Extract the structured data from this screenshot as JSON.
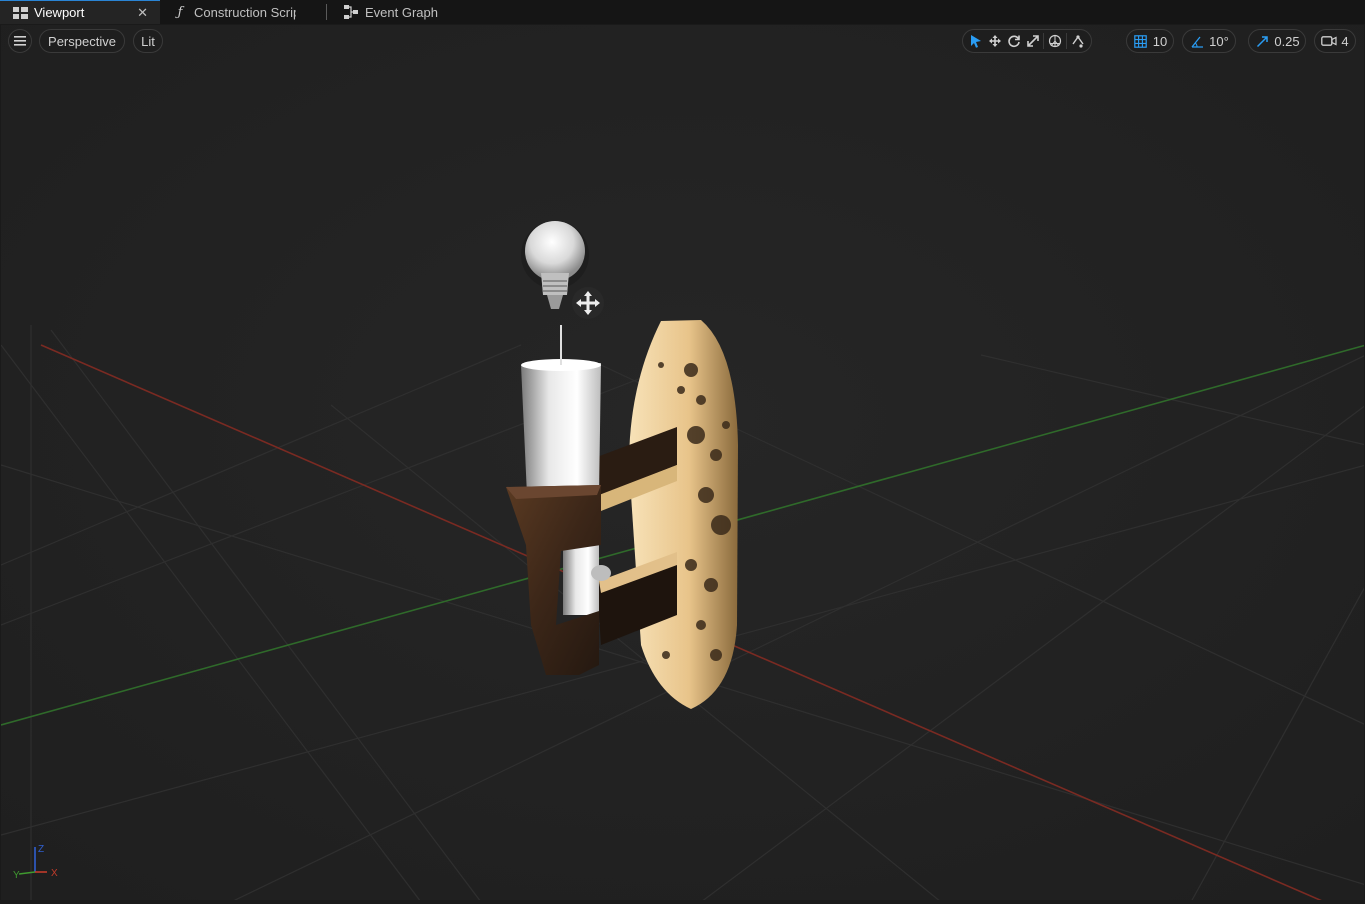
{
  "tabs": [
    {
      "label": "Viewport",
      "icon": "viewport-icon",
      "active": true
    },
    {
      "label": "Construction Script",
      "icon": "function-icon",
      "active": false
    },
    {
      "label": "Event Graph",
      "icon": "graph-icon",
      "active": false
    }
  ],
  "toolbar": {
    "menu_icon": "hamburger-menu-icon",
    "view_mode": "Perspective",
    "lighting_mode": "Lit",
    "grid_snap": "10",
    "rotation_snap": "10°",
    "scale_snap": "0.25",
    "camera_speed": "4"
  },
  "gizmo": {
    "x_label": "X",
    "y_label": "Y",
    "z_label": "Z"
  },
  "colors": {
    "accent": "#2a84d4",
    "viewport_bg": "#242424",
    "axis_x": "#c23b2a",
    "axis_y": "#3f9a2f",
    "axis_z": "#2f5fd0"
  }
}
